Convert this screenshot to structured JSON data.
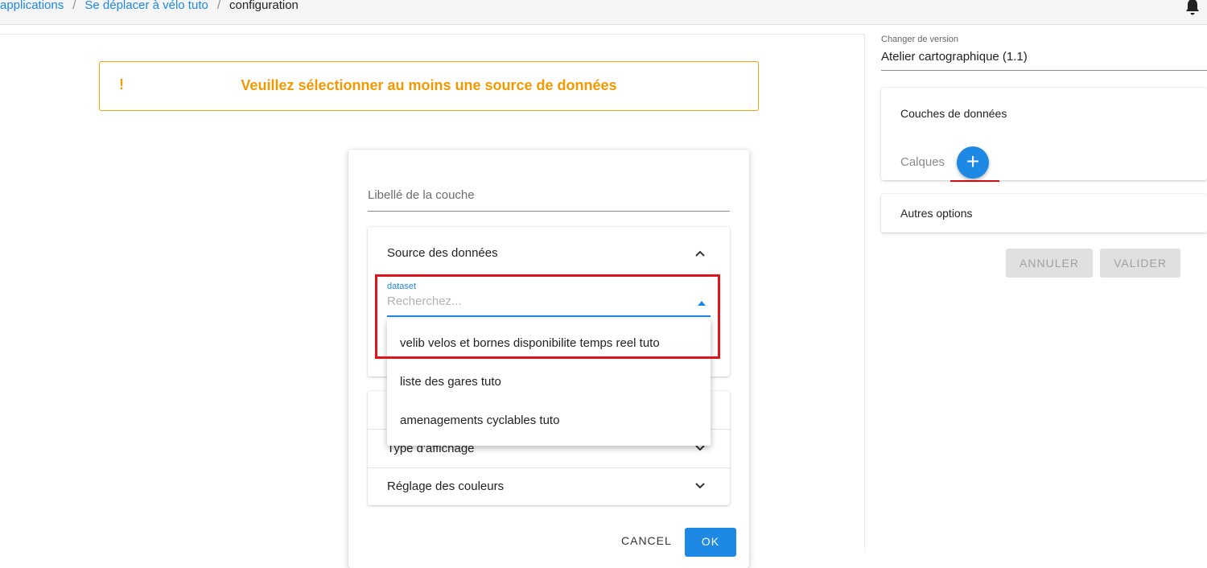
{
  "breadcrumb": {
    "items": [
      "applications",
      "Se déplacer à vélo tuto"
    ],
    "separator": "/",
    "current": "configuration"
  },
  "alert": {
    "icon_text": "!",
    "message": "Veuillez sélectionner au moins une source de données"
  },
  "dialog": {
    "label_placeholder": "Libellé de la couche",
    "source_panel": {
      "title": "Source des données",
      "dataset_label": "dataset",
      "search_placeholder": "Recherchez..."
    },
    "dropdown_options": [
      "velib velos et bornes disponibilite temps reel tuto",
      "liste des gares tuto",
      "amenagements cyclables tuto"
    ],
    "panels": {
      "display_type": "Type d'affichage",
      "colors": "Réglage des couleurs"
    },
    "cancel_label": "CANCEL",
    "ok_label": "OK"
  },
  "right_panel": {
    "version_label": "Changer de version",
    "version_value": "Atelier cartographique (1.1)",
    "data_layers_title": "Couches de données",
    "layers_label": "Calques",
    "add_symbol": "+",
    "other_options": "Autres options",
    "cancel_button": "ANNULER",
    "validate_button": "VALIDER"
  },
  "colors": {
    "accent": "#1e88e5",
    "warning": "#f29900",
    "highlight": "#e0141b"
  }
}
